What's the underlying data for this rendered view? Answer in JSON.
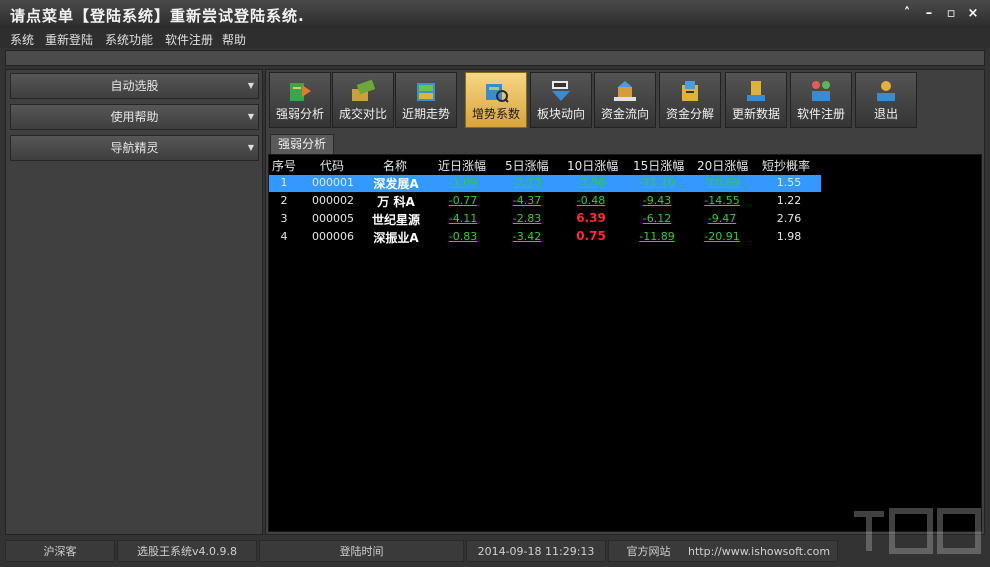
{
  "window": {
    "title": "请点菜单【登陆系统】重新尝试登陆系统."
  },
  "menu": [
    "系统",
    "重新登陆",
    "系统功能",
    "软件注册",
    "帮助"
  ],
  "left_panel": {
    "buttons": [
      "自动选股",
      "使用帮助",
      "导航精灵"
    ]
  },
  "toolbar": {
    "buttons": [
      {
        "label": "强弱分析",
        "icon": "strength-chart-icon"
      },
      {
        "label": "成交对比",
        "icon": "volume-compare-icon"
      },
      {
        "label": "近期走势",
        "icon": "trend-icon"
      },
      {
        "label": "增势系数",
        "icon": "growth-factor-icon",
        "active": true
      },
      {
        "label": "板块动向",
        "icon": "sector-move-icon"
      },
      {
        "label": "资金流向",
        "icon": "fund-flow-icon"
      },
      {
        "label": "资金分解",
        "icon": "fund-split-icon"
      },
      {
        "label": "更新数据",
        "icon": "update-data-icon"
      },
      {
        "label": "软件注册",
        "icon": "register-icon"
      },
      {
        "label": "退出",
        "icon": "exit-icon"
      }
    ]
  },
  "tab": {
    "label": "强弱分析"
  },
  "table": {
    "headers": [
      "序号",
      "代码",
      "名称",
      "近日涨幅",
      "5日涨幅",
      "10日涨幅",
      "15日涨幅",
      "20日涨幅",
      "短抄概率"
    ],
    "rows": [
      {
        "idx": "1",
        "code": "000001",
        "name": "深发展A",
        "d1": "-1.09",
        "d5": "-2.13",
        "d10": "-3.96",
        "d15": "-11.18",
        "d20": "-10.69",
        "prob": "1.55",
        "selected": true
      },
      {
        "idx": "2",
        "code": "000002",
        "name": "万 科A",
        "d1": "-0.77",
        "d5": "-4.37",
        "d10": "-0.48",
        "d15": "-9.43",
        "d20": "-14.55",
        "prob": "1.22"
      },
      {
        "idx": "3",
        "code": "000005",
        "name": "世纪星源",
        "d1": "-4.11",
        "d5": "-2.83",
        "d10": "6.39",
        "d15": "-6.12",
        "d20": "-9.47",
        "prob": "2.76"
      },
      {
        "idx": "4",
        "code": "000006",
        "name": "深振业A",
        "d1": "-0.83",
        "d5": "-3.42",
        "d10": "0.75",
        "d15": "-11.89",
        "d20": "-20.91",
        "prob": "1.98"
      }
    ]
  },
  "status": {
    "market": "沪深客",
    "version": "选股王系统v4.0.9.8",
    "login_label": "登陆时间",
    "login_time": "2014-09-18 11:29:13",
    "site_label": "官方网站",
    "site_url": "http://www.ishowsoft.com"
  },
  "colors": {
    "up": "#ff2a2a",
    "down": "#2fd02f",
    "selection": "#3399ff",
    "active_button": "#e8bd5a"
  }
}
